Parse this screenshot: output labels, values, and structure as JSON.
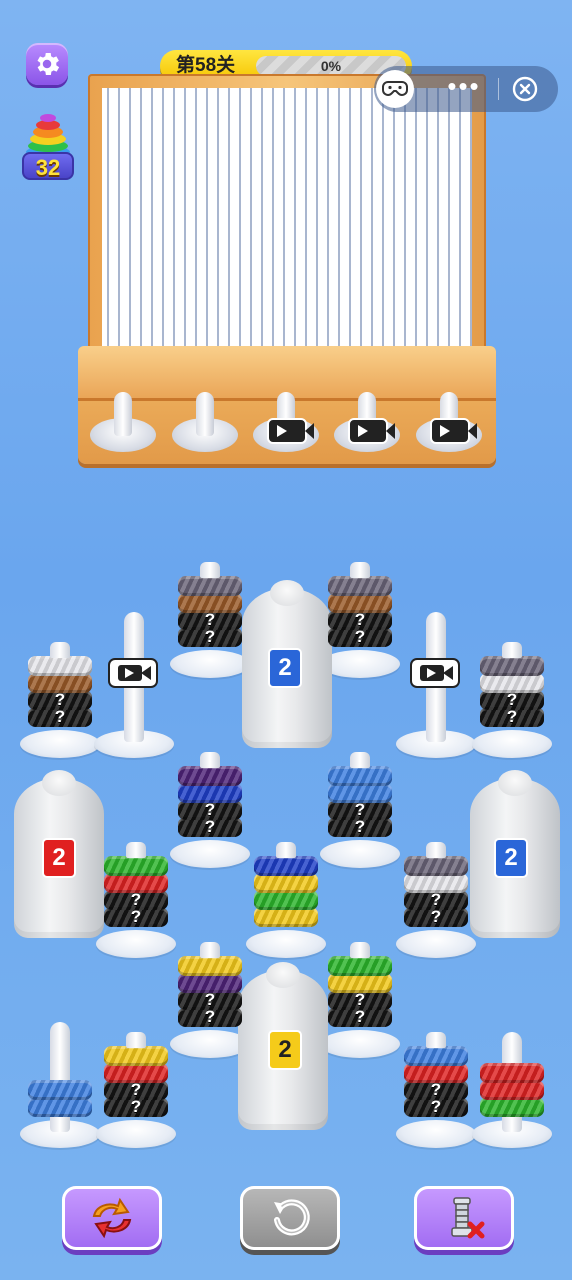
{
  "header": {
    "level_label": "第58关",
    "progress_text": "0%",
    "progress_fraction": 0.0,
    "stack_count": "32"
  },
  "icons": {
    "settings": "gear-icon",
    "stack": "rainbow-stack-icon",
    "game": "gamepad-icon",
    "more": "more-dots-icon",
    "close": "close-circle-icon"
  },
  "miniprogram": {
    "more_label": "•••"
  },
  "loom_spools": [
    {
      "locked": false
    },
    {
      "locked": false
    },
    {
      "locked": true
    },
    {
      "locked": true
    },
    {
      "locked": true
    }
  ],
  "colors": {
    "black": "#151515",
    "gray": "#6a6478",
    "brown": "#9a5a28",
    "white": "#e6e6ea",
    "purple": "#4e2379",
    "blue": "#1f3fc8",
    "lblue": "#3d7fe0",
    "green": "#2bb52b",
    "red": "#de2222",
    "yellow": "#f2c81a"
  },
  "pegs": [
    {
      "id": "p1",
      "rings": [
        "black",
        "black",
        "brown",
        "white"
      ],
      "hidden": [
        0,
        1
      ]
    },
    {
      "id": "p2",
      "rings": [],
      "locked": true
    },
    {
      "id": "p3",
      "rings": [
        "black",
        "black",
        "brown",
        "gray"
      ],
      "hidden": [
        0,
        1
      ]
    },
    {
      "id": "p4",
      "rings": [
        "black",
        "black",
        "brown",
        "gray"
      ],
      "hidden": [
        0,
        1
      ]
    },
    {
      "id": "p5",
      "rings": [],
      "locked": true
    },
    {
      "id": "p6",
      "rings": [
        "black",
        "black",
        "white",
        "gray"
      ],
      "hidden": [
        0,
        1
      ]
    },
    {
      "id": "p7",
      "rings": [
        "black",
        "black",
        "blue",
        "purple"
      ],
      "hidden": [
        0,
        1
      ]
    },
    {
      "id": "p8",
      "rings": [
        "black",
        "black",
        "lblue",
        "lblue"
      ],
      "hidden": [
        0,
        1
      ]
    },
    {
      "id": "p9",
      "rings": [
        "black",
        "black",
        "red",
        "green"
      ],
      "hidden": [
        0,
        1
      ]
    },
    {
      "id": "p10",
      "rings": [
        "yellow",
        "green",
        "yellow",
        "blue"
      ],
      "hidden": []
    },
    {
      "id": "p11",
      "rings": [
        "black",
        "black",
        "white",
        "gray"
      ],
      "hidden": [
        0,
        1
      ]
    },
    {
      "id": "p12",
      "rings": [
        "black",
        "black",
        "purple",
        "yellow"
      ],
      "hidden": [
        0,
        1
      ]
    },
    {
      "id": "p13",
      "rings": [
        "black",
        "black",
        "yellow",
        "green"
      ],
      "hidden": [
        0,
        1
      ]
    },
    {
      "id": "p14",
      "rings": [
        "lblue",
        "lblue"
      ],
      "hidden": []
    },
    {
      "id": "p15",
      "rings": [
        "black",
        "black",
        "red",
        "yellow"
      ],
      "hidden": [
        0,
        1
      ]
    },
    {
      "id": "p16",
      "rings": [
        "black",
        "black",
        "red",
        "lblue"
      ],
      "hidden": [
        0,
        1
      ]
    },
    {
      "id": "p17",
      "rings": [
        "green",
        "red",
        "red"
      ],
      "hidden": []
    }
  ],
  "covers": [
    {
      "id": "c1",
      "number": "2",
      "badge_color": "#2a66d8",
      "text_color": "#ffffff"
    },
    {
      "id": "c2",
      "number": "2",
      "badge_color": "#e02020",
      "text_color": "#ffffff"
    },
    {
      "id": "c3",
      "number": "2",
      "badge_color": "#2a66d8",
      "text_color": "#ffffff"
    },
    {
      "id": "c4",
      "number": "2",
      "badge_color": "#f5cb1a",
      "text_color": "#222222"
    }
  ],
  "hidden_mark": "?",
  "bottom_bar": {
    "shuffle": "shuffle-icon",
    "undo": "undo-icon",
    "remove": "remove-screw-icon"
  }
}
